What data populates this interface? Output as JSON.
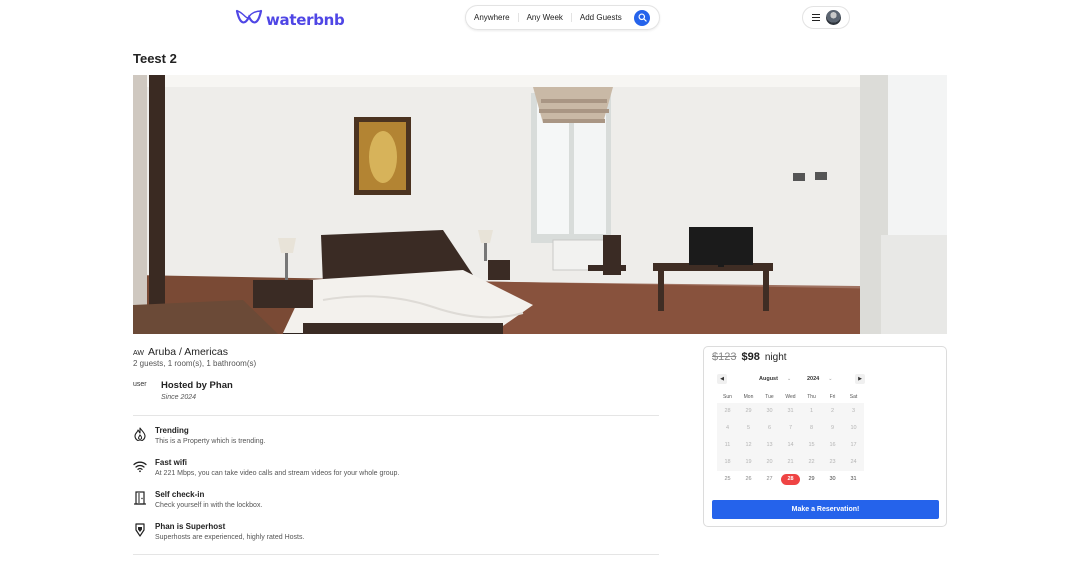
{
  "app": {
    "logo_text": "waterbnb",
    "brand_color": "#4f46e5",
    "accent_color": "#2563eb"
  },
  "search": {
    "anywhere": "Anywhere",
    "any_week": "Any Week",
    "add_guests": "Add Guests",
    "icon": "search-icon"
  },
  "user_menu": {
    "icon": "menu-icon",
    "avatar": "avatar"
  },
  "listing": {
    "title": "Teest 2",
    "country_code": "AW",
    "location": "Aruba / Americas",
    "specs": "2 guests,  1 room(s),  1 bathroom(s)",
    "host_img_alt": "user",
    "host_name": "Hosted by Phan",
    "host_since": "Since 2024"
  },
  "amenities": [
    {
      "icon": "flame-icon",
      "title": "Trending",
      "desc": "This is a Property which is trending."
    },
    {
      "icon": "wifi-icon",
      "title": "Fast wifi",
      "desc": "At 221 Mbps, you can take video calls and stream videos for your whole group."
    },
    {
      "icon": "door-icon",
      "title": "Self check-in",
      "desc": "Check yourself in with the lockbox."
    },
    {
      "icon": "superhost-icon",
      "title": "Phan is Superhost",
      "desc": "Superhosts are experienced, highly rated Hosts."
    }
  ],
  "booking": {
    "old_price": "$123",
    "new_price": "$98",
    "unit": "night",
    "reserve_label": "Make a Reservation!",
    "calendar": {
      "month": "August",
      "year": "2024",
      "weekdays": [
        "Sun",
        "Mon",
        "Tue",
        "Wed",
        "Thu",
        "Fri",
        "Sat"
      ],
      "days": [
        "28",
        "29",
        "30",
        "31",
        "1",
        "2",
        "3",
        "4",
        "5",
        "6",
        "7",
        "8",
        "9",
        "10",
        "11",
        "12",
        "13",
        "14",
        "15",
        "16",
        "17",
        "18",
        "19",
        "20",
        "21",
        "22",
        "23",
        "24",
        "25",
        "26",
        "27",
        "28",
        "29",
        "30",
        "31"
      ],
      "selected_index": 31,
      "selected_color": "#ef4444"
    }
  }
}
